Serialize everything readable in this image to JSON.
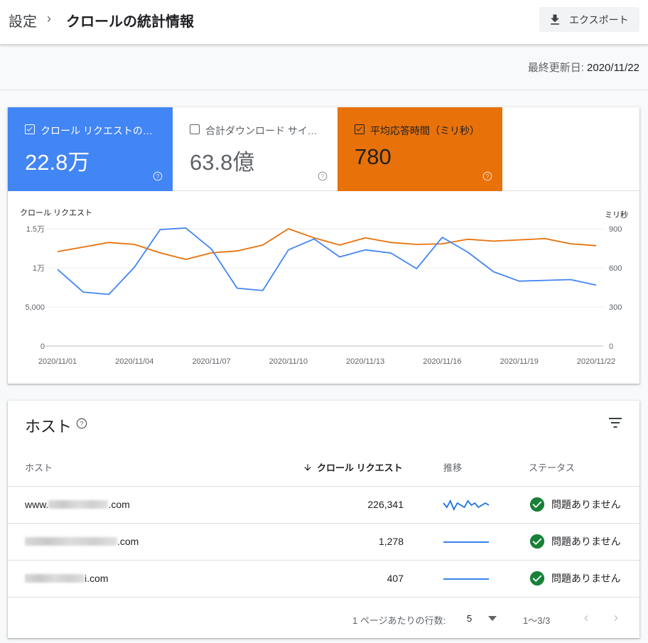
{
  "header": {
    "breadcrumb_root": "設定",
    "breadcrumb_sep": "›",
    "title": "クロールの統計情報",
    "export_label": "エクスポート"
  },
  "last_updated": {
    "label": "最終更新日:",
    "value": "2020/11/22"
  },
  "metrics": [
    {
      "label": "クロール リクエストの合計数",
      "value": "22.8万",
      "checked": true,
      "color": "#4285f4"
    },
    {
      "label": "合計ダウンロード サイズ（バイト）",
      "value": "63.8億",
      "checked": false,
      "color": "#ffffff"
    },
    {
      "label": "平均応答時間（ミリ秒）",
      "value": "780",
      "checked": true,
      "color": "#e8710a"
    }
  ],
  "chart_data": {
    "type": "line",
    "x": [
      "2020/11/01",
      "2020/11/02",
      "2020/11/03",
      "2020/11/04",
      "2020/11/05",
      "2020/11/06",
      "2020/11/07",
      "2020/11/08",
      "2020/11/09",
      "2020/11/10",
      "2020/11/11",
      "2020/11/12",
      "2020/11/13",
      "2020/11/14",
      "2020/11/15",
      "2020/11/16",
      "2020/11/17",
      "2020/11/18",
      "2020/11/19",
      "2020/11/20",
      "2020/11/21",
      "2020/11/22"
    ],
    "x_tick_labels": [
      "2020/11/01",
      "2020/11/04",
      "2020/11/07",
      "2020/11/10",
      "2020/11/13",
      "2020/11/16",
      "2020/11/19",
      "2020/11/22"
    ],
    "series": [
      {
        "name": "クロール リクエスト",
        "axis": "left",
        "color": "#4285f4",
        "values": [
          9800,
          6900,
          6600,
          10100,
          14900,
          15100,
          12400,
          7400,
          7100,
          12300,
          13700,
          11400,
          12300,
          11900,
          9900,
          13900,
          12000,
          9500,
          8300,
          8400,
          8500,
          7800
        ]
      },
      {
        "name": "ミリ秒",
        "axis": "right",
        "color": "#e8710a",
        "values": [
          725,
          760,
          795,
          780,
          715,
          665,
          715,
          730,
          775,
          900,
          830,
          775,
          830,
          795,
          780,
          785,
          820,
          805,
          815,
          825,
          785,
          770
        ]
      }
    ],
    "y_left": {
      "label": "クロール リクエスト",
      "ticks": [
        "0",
        "5,000",
        "1万",
        "1.5万"
      ],
      "min": 0,
      "max": 15000
    },
    "y_right": {
      "label": "ミリ秒",
      "ticks": [
        "0",
        "300",
        "600",
        "900"
      ],
      "min": 0,
      "max": 900
    },
    "grid": true
  },
  "hosts": {
    "title": "ホスト",
    "columns": {
      "host": "ホスト",
      "requests": "クロール リクエスト",
      "trend": "推移",
      "status": "ステータス"
    },
    "rows": [
      {
        "prefix": "www.",
        "suffix": ".com",
        "requests": "226,341",
        "status": "問題ありません",
        "trend": [
          5,
          3,
          6,
          2,
          5,
          4,
          3,
          6,
          4,
          5,
          3,
          4,
          5,
          4
        ]
      },
      {
        "prefix": "",
        "suffix": ".com",
        "requests": "1,278",
        "status": "問題ありません",
        "trend": [
          1,
          1,
          1,
          1,
          1,
          1,
          1,
          1,
          1,
          1,
          1,
          1,
          1,
          1
        ]
      },
      {
        "prefix": "",
        "suffix": "i.com",
        "requests": "407",
        "status": "問題ありません",
        "trend": [
          1,
          1,
          1,
          1,
          1,
          1,
          1,
          1,
          1,
          1,
          1,
          1,
          1,
          1
        ]
      }
    ],
    "pager": {
      "rows_label": "1 ページあたりの行数:",
      "rows_value": "5",
      "range": "1〜3/3"
    }
  },
  "colors": {
    "accent": "#4285f4",
    "orange": "#e8710a",
    "ok_green": "#188038",
    "spark": "#1a73e8"
  }
}
